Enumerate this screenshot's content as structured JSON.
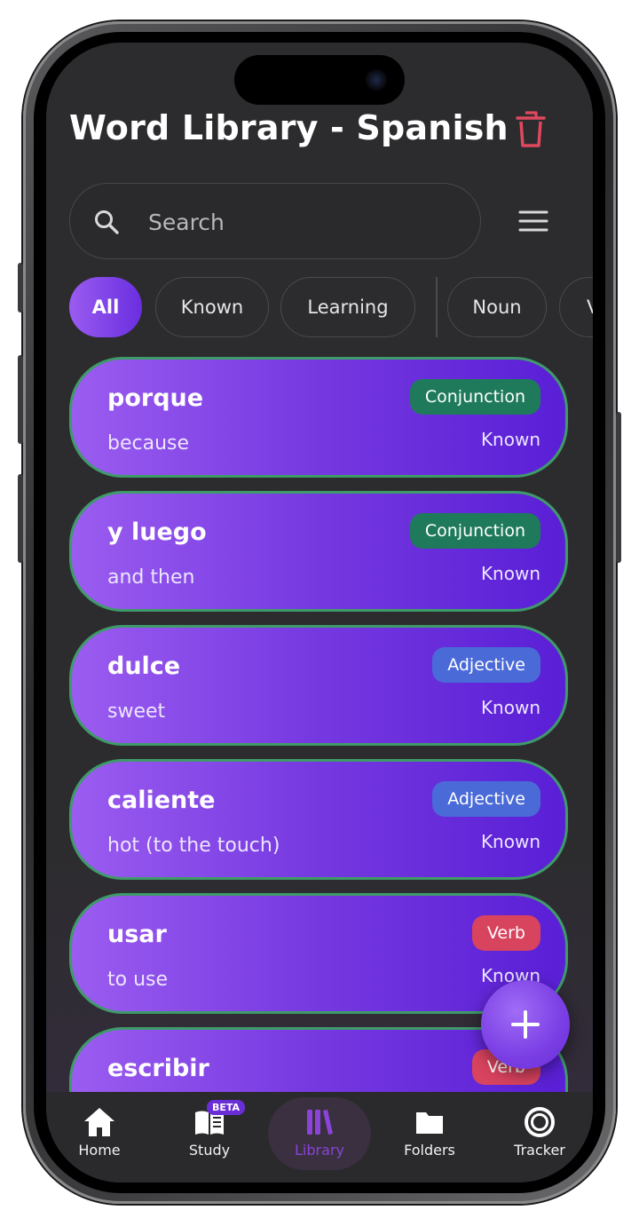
{
  "header": {
    "title": "Word Library - Spanish"
  },
  "search": {
    "placeholder": "Search",
    "value": ""
  },
  "filters": {
    "chips": [
      {
        "label": "All",
        "active": true
      },
      {
        "label": "Known",
        "active": false
      },
      {
        "label": "Learning",
        "active": false
      },
      {
        "label": "Noun",
        "active": false
      },
      {
        "label": "V",
        "active": false
      }
    ]
  },
  "words": [
    {
      "word": "porque",
      "meaning": "because",
      "type": "Conjunction",
      "status": "Known"
    },
    {
      "word": "y luego",
      "meaning": "and then",
      "type": "Conjunction",
      "status": "Known"
    },
    {
      "word": "dulce",
      "meaning": "sweet",
      "type": "Adjective",
      "status": "Known"
    },
    {
      "word": "caliente",
      "meaning": "hot (to the touch)",
      "type": "Adjective",
      "status": "Known"
    },
    {
      "word": "usar",
      "meaning": "to use",
      "type": "Verb",
      "status": "Known"
    },
    {
      "word": "escribir",
      "meaning": "",
      "type": "Verb",
      "status": ""
    }
  ],
  "type_colors": {
    "Conjunction": "#1f7a5c",
    "Adjective": "#4a6ad8",
    "Verb": "#d8435e"
  },
  "fab": {
    "icon": "plus-icon"
  },
  "nav": {
    "items": [
      {
        "label": "Home",
        "icon": "home-icon",
        "active": false
      },
      {
        "label": "Study",
        "icon": "book-icon",
        "active": false,
        "badge": "BETA"
      },
      {
        "label": "Library",
        "icon": "library-icon",
        "active": true
      },
      {
        "label": "Folders",
        "icon": "folder-icon",
        "active": false
      },
      {
        "label": "Tracker",
        "icon": "tracker-icon",
        "active": false
      }
    ]
  },
  "colors": {
    "accent": "#7a3ee4",
    "background": "#2c2c2e",
    "delete": "#e0485e",
    "card_border": "#3f9a6a"
  }
}
